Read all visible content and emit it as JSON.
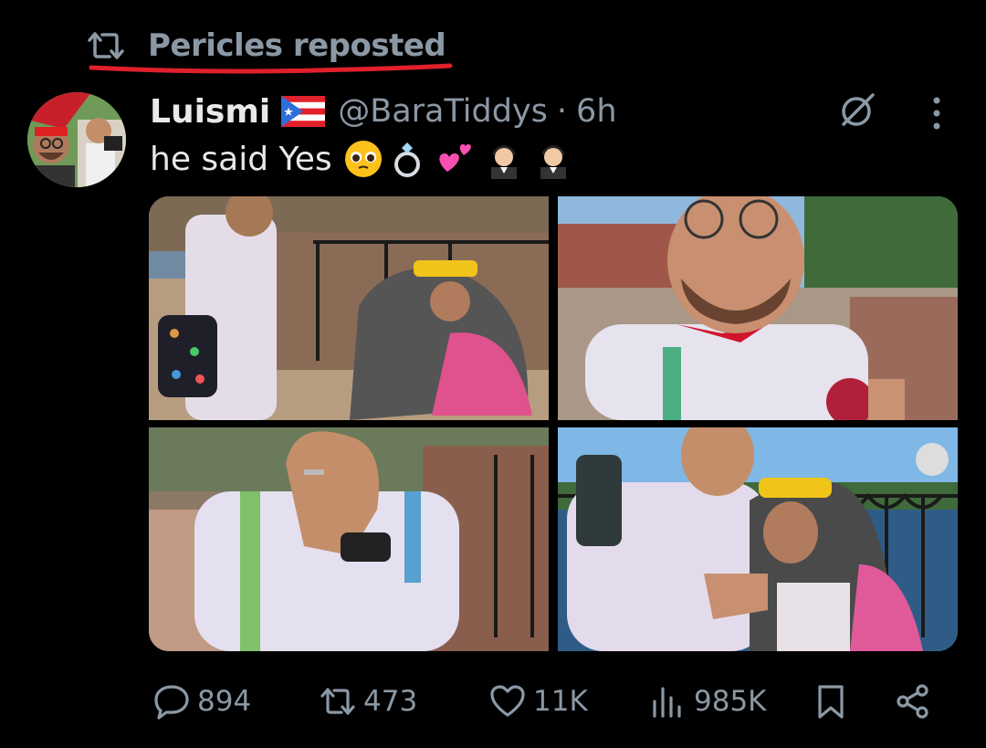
{
  "repost_banner": {
    "text": "Pericles reposted",
    "icon": "repost-icon"
  },
  "author": {
    "display_name": "Luismi",
    "flag_icon": "puerto-rico-flag-icon",
    "handle": "@BaraTiddys",
    "separator": "·",
    "time": "6h"
  },
  "tweet": {
    "text": "he said Yes",
    "emojis": [
      "pleading-face-emoji",
      "ring-emoji",
      "two-hearts-emoji",
      "man-in-tuxedo-emoji",
      "man-in-tuxedo-emoji"
    ]
  },
  "media": {
    "photos": [
      "photo-1",
      "photo-2",
      "photo-3",
      "photo-4"
    ]
  },
  "actions": {
    "replies": "894",
    "reposts": "473",
    "likes": "11K",
    "views": "985K"
  },
  "colors": {
    "background": "#000000",
    "text": "#e7e9ea",
    "muted": "#8b98a5",
    "annotation": "#e0202a"
  }
}
